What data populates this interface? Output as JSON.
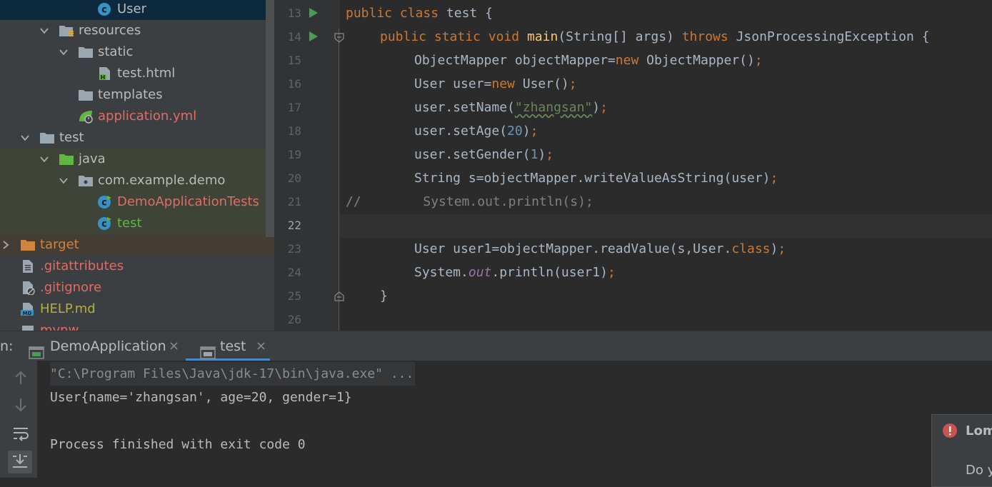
{
  "project_tree": {
    "items": [
      {
        "label": "User",
        "icon": "class-icon",
        "color": "default"
      },
      {
        "label": "resources",
        "icon": "resources-folder-icon",
        "color": "default"
      },
      {
        "label": "static",
        "icon": "folder-icon",
        "color": "default"
      },
      {
        "label": "test.html",
        "icon": "html-file-icon",
        "color": "default"
      },
      {
        "label": "templates",
        "icon": "folder-icon",
        "color": "default"
      },
      {
        "label": "application.yml",
        "icon": "spring-config-icon",
        "color": "red"
      },
      {
        "label": "test",
        "icon": "folder-icon",
        "color": "default"
      },
      {
        "label": "java",
        "icon": "test-source-folder-icon",
        "color": "default"
      },
      {
        "label": "com.example.demo",
        "icon": "package-icon",
        "color": "default"
      },
      {
        "label": "DemoApplicationTests",
        "icon": "test-class-icon",
        "color": "red"
      },
      {
        "label": "test",
        "icon": "test-class-icon",
        "color": "green"
      },
      {
        "label": "target",
        "icon": "excluded-folder-icon",
        "color": "orange"
      },
      {
        "label": ".gitattributes",
        "icon": "text-file-icon",
        "color": "red"
      },
      {
        "label": ".gitignore",
        "icon": "ignore-file-icon",
        "color": "red"
      },
      {
        "label": "HELP.md",
        "icon": "markdown-file-icon",
        "color": "olive"
      },
      {
        "label": "mvnw",
        "icon": "shell-file-icon",
        "color": "red"
      }
    ]
  },
  "editor": {
    "line_numbers": [
      "13",
      "14",
      "15",
      "16",
      "17",
      "18",
      "19",
      "20",
      "21",
      "22",
      "23",
      "24",
      "25",
      "26"
    ],
    "lines": {
      "l13": {
        "kw1": "public",
        "kw2": "class",
        "rest": " test {"
      },
      "l14": {
        "kw1": "public",
        "kw2": "static",
        "kw3": "void",
        "fn": "main",
        "mid": "(String[] args) ",
        "kw4": "throws",
        "rest": " JsonProcessingException {"
      },
      "l15": {
        "a": "ObjectMapper objectMapper=",
        "kw": "new",
        "b": " ObjectMapper()",
        "semi": ";"
      },
      "l16": {
        "a": "User user=",
        "kw": "new",
        "b": " User()",
        "semi": ";"
      },
      "l17": {
        "a": "user.setName(",
        "str": "\"zhangsan\"",
        "b": ")",
        "semi": ";"
      },
      "l18": {
        "a": "user.setAge(",
        "num": "20",
        "b": ")",
        "semi": ";"
      },
      "l19": {
        "a": "user.setGender(",
        "num": "1",
        "b": ")",
        "semi": ";"
      },
      "l20": {
        "a": "String s=objectMapper.writeValueAsString(user)",
        "semi": ";"
      },
      "l21": {
        "comment": "//        System.out.println(s);"
      },
      "l23": {
        "a": "User user1=objectMapper.readValue(s,User.",
        "kw": "class",
        "b": ")",
        "semi": ";"
      },
      "l24": {
        "a": "System.",
        "fld": "out",
        "b": ".println(user1)",
        "semi": ";"
      },
      "l25": {
        "a": "}"
      }
    }
  },
  "run_panel": {
    "label_prefix": "n:",
    "tabs": [
      {
        "label": "DemoApplication",
        "close": "×",
        "active": false
      },
      {
        "label": "test",
        "close": "×",
        "active": true
      }
    ],
    "console": [
      "\"C:\\Program Files\\Java\\jdk-17\\bin\\java.exe\" ...",
      "User{name='zhangsan', age=20, gender=1}",
      "",
      "Process finished with exit code 0"
    ]
  },
  "notification": {
    "title": "Lom",
    "body": "Do y"
  },
  "colors": {
    "tree_bg": "#3c3f41",
    "editor_bg": "#2b2b2b",
    "keyword": "#cc7832",
    "string": "#6a8759",
    "number": "#6897bb",
    "method_decl": "#ffc66d",
    "run_green": "#499c54",
    "error_red": "#c75450"
  }
}
